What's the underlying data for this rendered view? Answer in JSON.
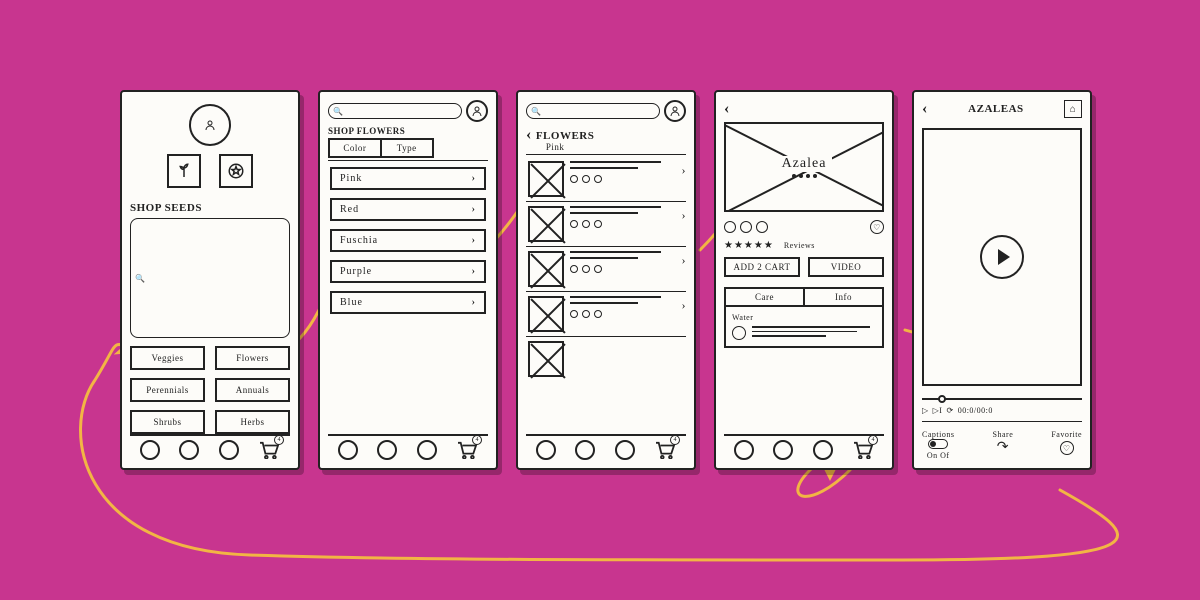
{
  "screen1": {
    "heading": "Shop Seeds",
    "search_placeholder": "🔍",
    "categories": [
      "Veggies",
      "Flowers",
      "Perennials",
      "Annuals",
      "Shrubs",
      "Herbs"
    ],
    "highlighted_category_index": 1
  },
  "screen2": {
    "breadcrumb": "Shop Flowers",
    "tabs": [
      "Color",
      "Type"
    ],
    "active_tab_index": 0,
    "colors": [
      "Pink",
      "Red",
      "Fuschia",
      "Purple",
      "Blue"
    ],
    "highlighted_color_index": 0
  },
  "screen3": {
    "title": "Flowers",
    "subtitle": "Pink",
    "item_count": 5
  },
  "screen4": {
    "product_name": "Azalea",
    "reviews_label": "Reviews",
    "add_to_cart_label": "Add 2 Cart",
    "video_label": "Video",
    "tabs": [
      "Care",
      "Info"
    ],
    "care_section": "Water"
  },
  "screen5": {
    "title": "Azaleas",
    "timecode": "00:0/00:0",
    "captions_label": "Captions",
    "captions_on": "On",
    "captions_off": "Of",
    "share_label": "Share",
    "favorite_label": "Favorite"
  },
  "colors": {
    "background": "#c8358f",
    "highlight": "#ef7bb0",
    "arrow": "#f2b544",
    "ink": "#222"
  }
}
